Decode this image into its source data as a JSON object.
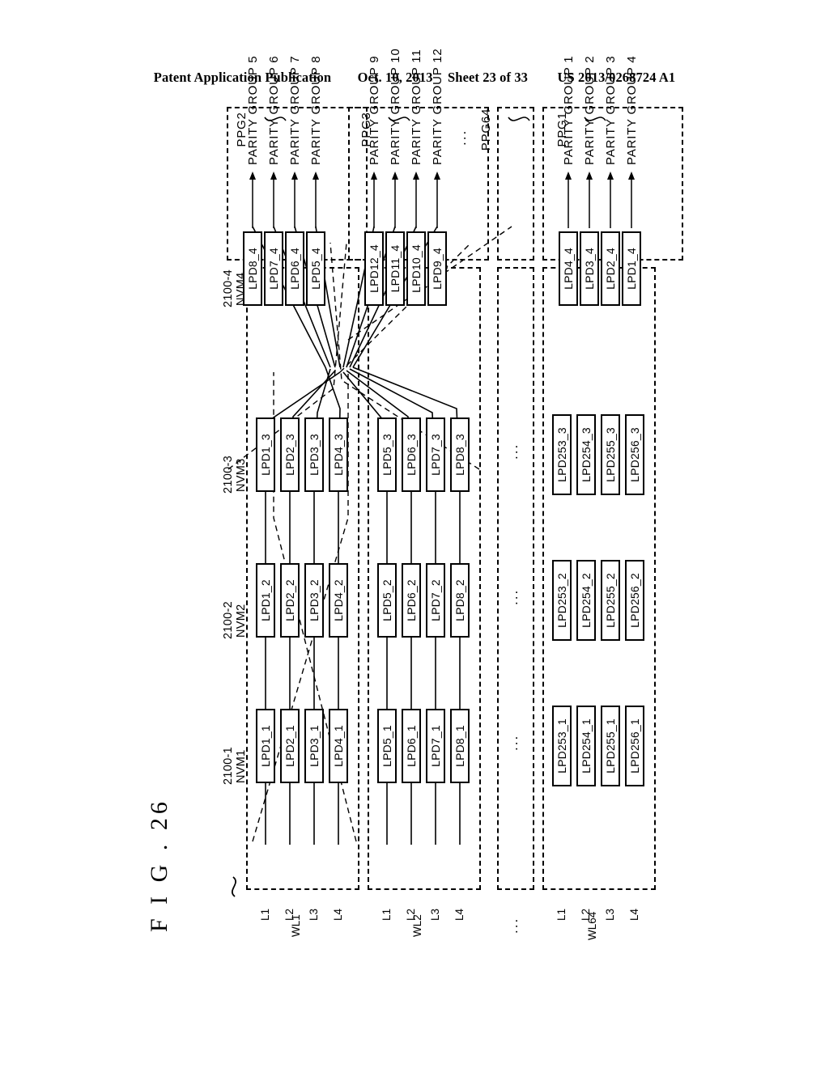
{
  "header": {
    "publication": "Patent Application Publication",
    "date": "Oct. 10, 2013",
    "sheet": "Sheet 23 of 33",
    "patent_number": "US 2013/0268724 A1"
  },
  "figure": {
    "title": "F I G .  26",
    "ellipsis": "...",
    "device_refs": [
      {
        "ref": "2100-1",
        "name": "NVM1"
      },
      {
        "ref": "2100-2",
        "name": "NVM2"
      },
      {
        "ref": "2100-3",
        "name": "NVM3"
      },
      {
        "ref": "2100-4",
        "name": "NVM4"
      }
    ],
    "wordlines": [
      {
        "name": "WL1",
        "levels": [
          "L1",
          "L2",
          "L3",
          "L4"
        ]
      },
      {
        "name": "WL2",
        "levels": [
          "L1",
          "L2",
          "L3",
          "L4"
        ]
      },
      {
        "name": "WL64",
        "levels": [
          "L1",
          "L2",
          "L3",
          "L4"
        ]
      }
    ],
    "parity_page_groups": [
      {
        "id": "PPG1",
        "groups": [
          "PARITY GROUP 1",
          "PARITY GROUP 2",
          "PARITY GROUP 3",
          "PARITY GROUP 4"
        ]
      },
      {
        "id": "PPG2",
        "groups": [
          "PARITY GROUP 5",
          "PARITY GROUP 6",
          "PARITY GROUP 7",
          "PARITY GROUP 8"
        ]
      },
      {
        "id": "PPG3",
        "groups": [
          "PARITY GROUP 9",
          "PARITY GROUP 10",
          "PARITY GROUP 11",
          "PARITY GROUP 12"
        ]
      },
      {
        "id": "PPG64",
        "groups": []
      }
    ],
    "blocks": {
      "wl1_nvm1": [
        "LPD1_1",
        "LPD2_1",
        "LPD3_1",
        "LPD4_1"
      ],
      "wl1_nvm2": [
        "LPD1_2",
        "LPD2_2",
        "LPD3_2",
        "LPD4_2"
      ],
      "wl1_nvm3": [
        "LPD1_3",
        "LPD2_3",
        "LPD3_3",
        "LPD4_3"
      ],
      "wl1_nvm4": [
        "LPD8_4",
        "LPD7_4",
        "LPD6_4",
        "LPD5_4"
      ],
      "wl2_nvm1": [
        "LPD5_1",
        "LPD6_1",
        "LPD7_1",
        "LPD8_1"
      ],
      "wl2_nvm2": [
        "LPD5_2",
        "LPD6_2",
        "LPD7_2",
        "LPD8_2"
      ],
      "wl2_nvm3": [
        "LPD5_3",
        "LPD6_3",
        "LPD7_3",
        "LPD8_3"
      ],
      "wl2_nvm4": [
        "LPD12_4",
        "LPD11_4",
        "LPD10_4",
        "LPD9_4"
      ],
      "wl64_nvm1": [
        "LPD253_1",
        "LPD254_1",
        "LPD255_1",
        "LPD256_1"
      ],
      "wl64_nvm2": [
        "LPD253_2",
        "LPD254_2",
        "LPD255_2",
        "LPD256_2"
      ],
      "wl64_nvm3": [
        "LPD253_3",
        "LPD254_3",
        "LPD255_3",
        "LPD256_3"
      ],
      "wl64_nvm4": [
        "LPD4_4",
        "LPD3_4",
        "LPD2_4",
        "LPD1_4"
      ]
    }
  }
}
